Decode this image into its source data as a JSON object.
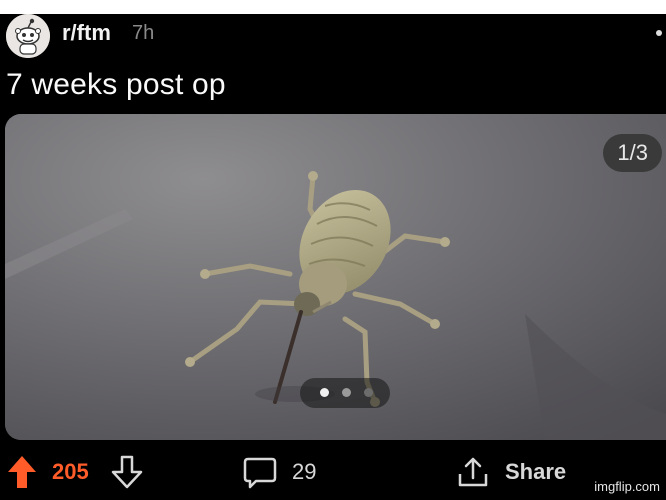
{
  "post": {
    "subreddit": "r/ftm",
    "age": "7h",
    "title": "7 weeks post op",
    "media_counter": "1/3",
    "carousel": {
      "pages": 3,
      "current": 1
    }
  },
  "actions": {
    "upvotes": "205",
    "comments": "29",
    "share_label": "Share"
  },
  "watermark": "imgflip.com",
  "colors": {
    "upvote_active": "#ff5c2a",
    "background": "#000000",
    "text_muted": "#8a8a8a"
  },
  "icons": [
    "reddit-avatar-icon",
    "more-options-icon",
    "upvote-arrow-icon",
    "downvote-arrow-icon",
    "comment-bubble-icon",
    "share-icon"
  ]
}
